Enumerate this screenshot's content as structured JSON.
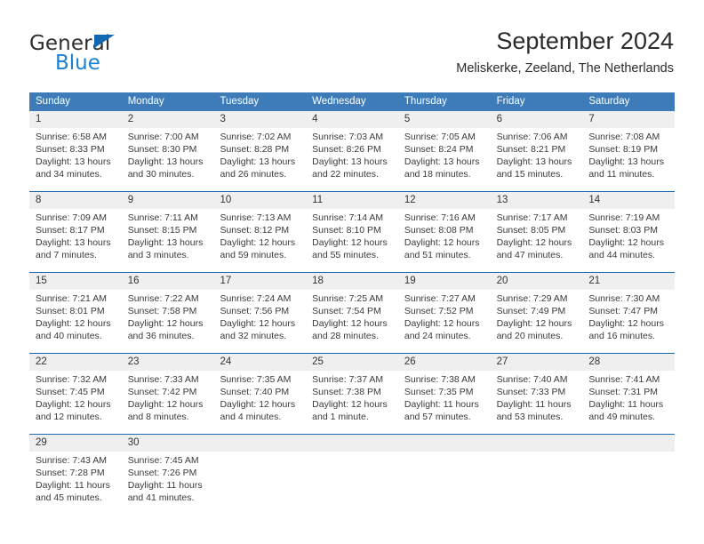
{
  "brand": {
    "name_part1": "General",
    "name_part2": "Blue",
    "triangle_color": "#1268b3",
    "blue_color": "#1b7fd4"
  },
  "header": {
    "title": "September 2024",
    "subtitle": "Meliskerke, Zeeland, The Netherlands"
  },
  "theme": {
    "header_bg": "#3d7cb8",
    "row_border": "#1d6ab0",
    "daynum_band": "#efefef"
  },
  "weekdays": [
    "Sunday",
    "Monday",
    "Tuesday",
    "Wednesday",
    "Thursday",
    "Friday",
    "Saturday"
  ],
  "weeks": [
    [
      {
        "day": "1",
        "sunrise": "Sunrise: 6:58 AM",
        "sunset": "Sunset: 8:33 PM",
        "daylight1": "Daylight: 13 hours",
        "daylight2": "and 34 minutes."
      },
      {
        "day": "2",
        "sunrise": "Sunrise: 7:00 AM",
        "sunset": "Sunset: 8:30 PM",
        "daylight1": "Daylight: 13 hours",
        "daylight2": "and 30 minutes."
      },
      {
        "day": "3",
        "sunrise": "Sunrise: 7:02 AM",
        "sunset": "Sunset: 8:28 PM",
        "daylight1": "Daylight: 13 hours",
        "daylight2": "and 26 minutes."
      },
      {
        "day": "4",
        "sunrise": "Sunrise: 7:03 AM",
        "sunset": "Sunset: 8:26 PM",
        "daylight1": "Daylight: 13 hours",
        "daylight2": "and 22 minutes."
      },
      {
        "day": "5",
        "sunrise": "Sunrise: 7:05 AM",
        "sunset": "Sunset: 8:24 PM",
        "daylight1": "Daylight: 13 hours",
        "daylight2": "and 18 minutes."
      },
      {
        "day": "6",
        "sunrise": "Sunrise: 7:06 AM",
        "sunset": "Sunset: 8:21 PM",
        "daylight1": "Daylight: 13 hours",
        "daylight2": "and 15 minutes."
      },
      {
        "day": "7",
        "sunrise": "Sunrise: 7:08 AM",
        "sunset": "Sunset: 8:19 PM",
        "daylight1": "Daylight: 13 hours",
        "daylight2": "and 11 minutes."
      }
    ],
    [
      {
        "day": "8",
        "sunrise": "Sunrise: 7:09 AM",
        "sunset": "Sunset: 8:17 PM",
        "daylight1": "Daylight: 13 hours",
        "daylight2": "and 7 minutes."
      },
      {
        "day": "9",
        "sunrise": "Sunrise: 7:11 AM",
        "sunset": "Sunset: 8:15 PM",
        "daylight1": "Daylight: 13 hours",
        "daylight2": "and 3 minutes."
      },
      {
        "day": "10",
        "sunrise": "Sunrise: 7:13 AM",
        "sunset": "Sunset: 8:12 PM",
        "daylight1": "Daylight: 12 hours",
        "daylight2": "and 59 minutes."
      },
      {
        "day": "11",
        "sunrise": "Sunrise: 7:14 AM",
        "sunset": "Sunset: 8:10 PM",
        "daylight1": "Daylight: 12 hours",
        "daylight2": "and 55 minutes."
      },
      {
        "day": "12",
        "sunrise": "Sunrise: 7:16 AM",
        "sunset": "Sunset: 8:08 PM",
        "daylight1": "Daylight: 12 hours",
        "daylight2": "and 51 minutes."
      },
      {
        "day": "13",
        "sunrise": "Sunrise: 7:17 AM",
        "sunset": "Sunset: 8:05 PM",
        "daylight1": "Daylight: 12 hours",
        "daylight2": "and 47 minutes."
      },
      {
        "day": "14",
        "sunrise": "Sunrise: 7:19 AM",
        "sunset": "Sunset: 8:03 PM",
        "daylight1": "Daylight: 12 hours",
        "daylight2": "and 44 minutes."
      }
    ],
    [
      {
        "day": "15",
        "sunrise": "Sunrise: 7:21 AM",
        "sunset": "Sunset: 8:01 PM",
        "daylight1": "Daylight: 12 hours",
        "daylight2": "and 40 minutes."
      },
      {
        "day": "16",
        "sunrise": "Sunrise: 7:22 AM",
        "sunset": "Sunset: 7:58 PM",
        "daylight1": "Daylight: 12 hours",
        "daylight2": "and 36 minutes."
      },
      {
        "day": "17",
        "sunrise": "Sunrise: 7:24 AM",
        "sunset": "Sunset: 7:56 PM",
        "daylight1": "Daylight: 12 hours",
        "daylight2": "and 32 minutes."
      },
      {
        "day": "18",
        "sunrise": "Sunrise: 7:25 AM",
        "sunset": "Sunset: 7:54 PM",
        "daylight1": "Daylight: 12 hours",
        "daylight2": "and 28 minutes."
      },
      {
        "day": "19",
        "sunrise": "Sunrise: 7:27 AM",
        "sunset": "Sunset: 7:52 PM",
        "daylight1": "Daylight: 12 hours",
        "daylight2": "and 24 minutes."
      },
      {
        "day": "20",
        "sunrise": "Sunrise: 7:29 AM",
        "sunset": "Sunset: 7:49 PM",
        "daylight1": "Daylight: 12 hours",
        "daylight2": "and 20 minutes."
      },
      {
        "day": "21",
        "sunrise": "Sunrise: 7:30 AM",
        "sunset": "Sunset: 7:47 PM",
        "daylight1": "Daylight: 12 hours",
        "daylight2": "and 16 minutes."
      }
    ],
    [
      {
        "day": "22",
        "sunrise": "Sunrise: 7:32 AM",
        "sunset": "Sunset: 7:45 PM",
        "daylight1": "Daylight: 12 hours",
        "daylight2": "and 12 minutes."
      },
      {
        "day": "23",
        "sunrise": "Sunrise: 7:33 AM",
        "sunset": "Sunset: 7:42 PM",
        "daylight1": "Daylight: 12 hours",
        "daylight2": "and 8 minutes."
      },
      {
        "day": "24",
        "sunrise": "Sunrise: 7:35 AM",
        "sunset": "Sunset: 7:40 PM",
        "daylight1": "Daylight: 12 hours",
        "daylight2": "and 4 minutes."
      },
      {
        "day": "25",
        "sunrise": "Sunrise: 7:37 AM",
        "sunset": "Sunset: 7:38 PM",
        "daylight1": "Daylight: 12 hours",
        "daylight2": "and 1 minute."
      },
      {
        "day": "26",
        "sunrise": "Sunrise: 7:38 AM",
        "sunset": "Sunset: 7:35 PM",
        "daylight1": "Daylight: 11 hours",
        "daylight2": "and 57 minutes."
      },
      {
        "day": "27",
        "sunrise": "Sunrise: 7:40 AM",
        "sunset": "Sunset: 7:33 PM",
        "daylight1": "Daylight: 11 hours",
        "daylight2": "and 53 minutes."
      },
      {
        "day": "28",
        "sunrise": "Sunrise: 7:41 AM",
        "sunset": "Sunset: 7:31 PM",
        "daylight1": "Daylight: 11 hours",
        "daylight2": "and 49 minutes."
      }
    ],
    [
      {
        "day": "29",
        "sunrise": "Sunrise: 7:43 AM",
        "sunset": "Sunset: 7:28 PM",
        "daylight1": "Daylight: 11 hours",
        "daylight2": "and 45 minutes."
      },
      {
        "day": "30",
        "sunrise": "Sunrise: 7:45 AM",
        "sunset": "Sunset: 7:26 PM",
        "daylight1": "Daylight: 11 hours",
        "daylight2": "and 41 minutes."
      },
      {
        "day": "",
        "sunrise": "",
        "sunset": "",
        "daylight1": "",
        "daylight2": ""
      },
      {
        "day": "",
        "sunrise": "",
        "sunset": "",
        "daylight1": "",
        "daylight2": ""
      },
      {
        "day": "",
        "sunrise": "",
        "sunset": "",
        "daylight1": "",
        "daylight2": ""
      },
      {
        "day": "",
        "sunrise": "",
        "sunset": "",
        "daylight1": "",
        "daylight2": ""
      },
      {
        "day": "",
        "sunrise": "",
        "sunset": "",
        "daylight1": "",
        "daylight2": ""
      }
    ]
  ]
}
